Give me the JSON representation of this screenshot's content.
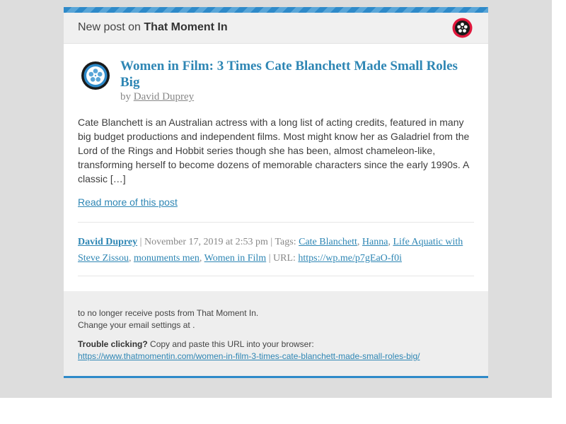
{
  "header": {
    "prefix": "New post on",
    "site_name": "That Moment In"
  },
  "post": {
    "title": "Women in Film: 3 Times Cate Blanchett Made Small Roles Big",
    "by_label": "by",
    "author": "David Duprey",
    "excerpt": "Cate Blanchett is an Australian actress with a long list of acting credits, featured in many big budget productions and independent films. Most might know her as Galadriel from the Lord of the Rings and Hobbit series though she has been, almost chameleon-like, transforming herself to become dozens of memorable characters since the early 1990s. A classic […]",
    "read_more": "Read more of this post"
  },
  "meta": {
    "author": "David Duprey",
    "date_text": " | November 17, 2019 at 2:53 pm | Tags: ",
    "tags": [
      "Cate Blanchett",
      "Hanna",
      "Life Aquatic with Steve Zissou",
      "monuments men",
      "Women in Film"
    ],
    "url_label": " | URL: ",
    "shortlink": "https://wp.me/p7gEaO-f0i"
  },
  "footer": {
    "unsubscribe": "to no longer receive posts from That Moment In.",
    "settings": "Change your email settings at .",
    "trouble_label": "Trouble clicking?",
    "trouble_text": " Copy and paste this URL into your browser:",
    "long_url": "https://www.thatmomentin.com/women-in-film-3-times-cate-blanchett-made-small-roles-big/"
  },
  "colors": {
    "accent": "#2e86b4",
    "page_bg": "#dddddd",
    "header_bg": "#f0f0f0",
    "footer_bg": "#eeeeee",
    "logo_red": "#e0173c"
  },
  "icons": {
    "site": "film-reel-icon",
    "blavatar": "film-reel-icon"
  }
}
